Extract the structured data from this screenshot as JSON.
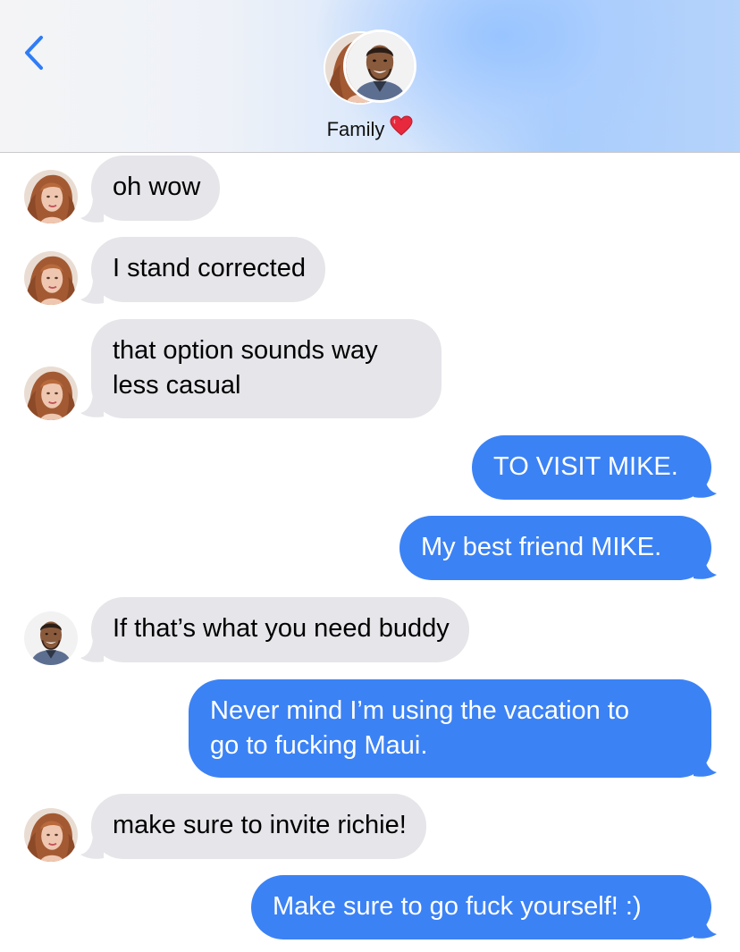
{
  "header": {
    "back_icon": "chevron-left-icon",
    "group_name": "Family",
    "heart_icon": "heart-icon",
    "accent": "#3b82f5"
  },
  "messages": [
    {
      "direction": "in",
      "sender": "woman",
      "text": "oh wow"
    },
    {
      "direction": "in",
      "sender": "woman",
      "text": "I stand corrected"
    },
    {
      "direction": "in",
      "sender": "woman",
      "lines": [
        "that option sounds way",
        "less casual"
      ]
    },
    {
      "direction": "out",
      "text": "TO VISIT MIKE."
    },
    {
      "direction": "out",
      "text": "My best friend MIKE."
    },
    {
      "direction": "in",
      "sender": "man",
      "text": "If that’s what you need buddy"
    },
    {
      "direction": "out",
      "lines": [
        "Never mind I’m using the vacation to",
        "go to fucking Maui."
      ]
    },
    {
      "direction": "in",
      "sender": "woman",
      "text": "make sure to invite richie!"
    },
    {
      "direction": "out",
      "text": "Make sure to go fuck yourself! :)"
    }
  ],
  "colors": {
    "incoming_bubble": "#e5e5ea",
    "outgoing_bubble": "#3b82f5",
    "heart": "#e8283c"
  }
}
